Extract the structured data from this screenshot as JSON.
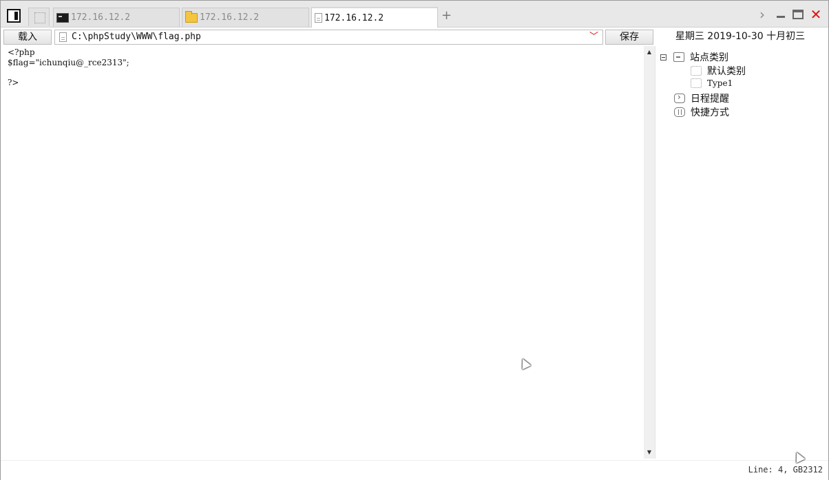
{
  "tabs": [
    {
      "label": "172.16.12.2",
      "icon": "terminal-icon",
      "active": false
    },
    {
      "label": "172.16.12.2",
      "icon": "folder-icon",
      "active": false
    },
    {
      "label": "172.16.12.2",
      "icon": "file-icon",
      "active": true
    }
  ],
  "tabstrip": {
    "add_symbol": "+"
  },
  "window": {
    "chevron": "›",
    "close_symbol": "✕"
  },
  "toolbar": {
    "load_label": "载入",
    "path_value": "C:\\phpStudy\\WWW\\flag.php",
    "dropdown_symbol": "﹀",
    "save_label": "保存",
    "date_label": "星期三  2019-10-30  十月初三"
  },
  "editor": {
    "lines": [
      "<?php",
      "$flag=\"ichunqiu@_rce2313\";",
      "",
      "?>"
    ]
  },
  "scrollbar": {
    "up": "▲",
    "down": "▼"
  },
  "sidebar": {
    "root": {
      "label": "站点类别",
      "children": [
        "默认类别",
        "Type1"
      ]
    },
    "items": [
      "日程提醒",
      "快捷方式"
    ]
  },
  "statusbar": {
    "text": "Line: 4, GB2312"
  },
  "colors": {
    "close": "#e01010",
    "dropdown": "#dd1111",
    "folder": "#f5c542"
  }
}
